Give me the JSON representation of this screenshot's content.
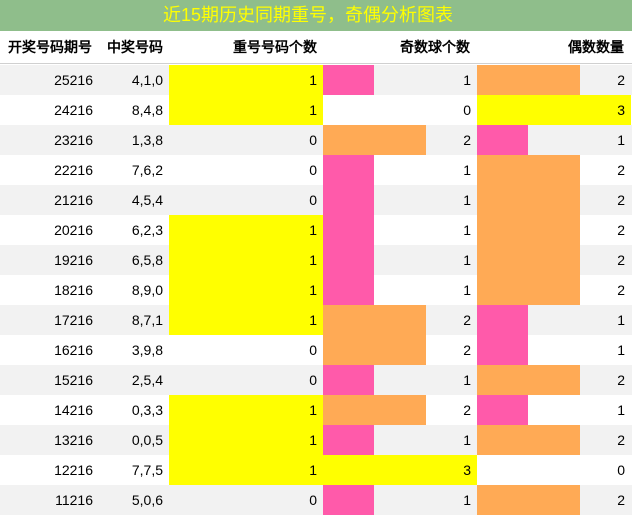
{
  "title": "近15期历史同期重号，奇偶分析图表",
  "headers": {
    "issue": "开奖号码期号",
    "numbers": "中奖号码",
    "repeat": "重号号码个数",
    "odd": "奇数球个数",
    "even": "偶数数量"
  },
  "colors": {
    "title_bg": "#8fbe8b",
    "title_text": "#ffff00",
    "yellow": "#ffff00",
    "pink": "#ff5aaa",
    "orange": "#ffaa55",
    "row_alt": "#f2f2f2"
  },
  "rows": [
    {
      "issue": "25216",
      "numbers": "4,1,0",
      "repeat": "1",
      "odd": "1",
      "even": "2"
    },
    {
      "issue": "24216",
      "numbers": "8,4,8",
      "repeat": "1",
      "odd": "0",
      "even": "3"
    },
    {
      "issue": "23216",
      "numbers": "1,3,8",
      "repeat": "0",
      "odd": "2",
      "even": "1"
    },
    {
      "issue": "22216",
      "numbers": "7,6,2",
      "repeat": "0",
      "odd": "1",
      "even": "2"
    },
    {
      "issue": "21216",
      "numbers": "4,5,4",
      "repeat": "0",
      "odd": "1",
      "even": "2"
    },
    {
      "issue": "20216",
      "numbers": "6,2,3",
      "repeat": "1",
      "odd": "1",
      "even": "2"
    },
    {
      "issue": "19216",
      "numbers": "6,5,8",
      "repeat": "1",
      "odd": "1",
      "even": "2"
    },
    {
      "issue": "18216",
      "numbers": "8,9,0",
      "repeat": "1",
      "odd": "1",
      "even": "2"
    },
    {
      "issue": "17216",
      "numbers": "8,7,1",
      "repeat": "1",
      "odd": "2",
      "even": "1"
    },
    {
      "issue": "16216",
      "numbers": "3,9,8",
      "repeat": "0",
      "odd": "2",
      "even": "1"
    },
    {
      "issue": "15216",
      "numbers": "2,5,4",
      "repeat": "0",
      "odd": "1",
      "even": "2"
    },
    {
      "issue": "14216",
      "numbers": "0,3,3",
      "repeat": "1",
      "odd": "2",
      "even": "1"
    },
    {
      "issue": "13216",
      "numbers": "0,0,5",
      "repeat": "1",
      "odd": "1",
      "even": "2"
    },
    {
      "issue": "12216",
      "numbers": "7,7,5",
      "repeat": "1",
      "odd": "3",
      "even": "0"
    },
    {
      "issue": "11216",
      "numbers": "5,0,6",
      "repeat": "0",
      "odd": "1",
      "even": "2"
    }
  ]
}
